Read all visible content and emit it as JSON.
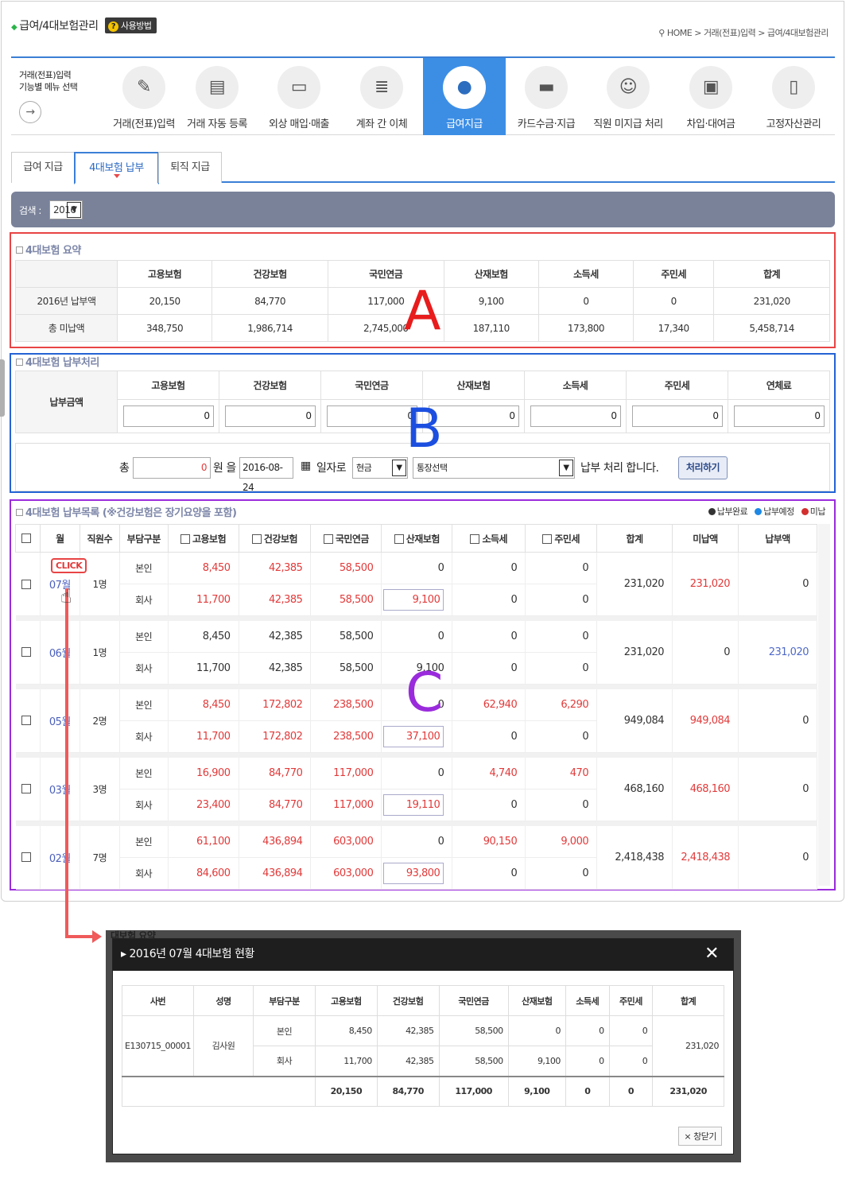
{
  "header": {
    "title": "급여/4대보험관리",
    "help_label": "사용방법",
    "breadcrumb": "HOME > 거래(전표)입력 > 급여/4대보험관리"
  },
  "menu": {
    "intro": "거래(전표)입력\n기능별 메뉴 선택",
    "items": [
      {
        "label": "거래(전표)입력",
        "icon": "document-edit-icon"
      },
      {
        "label": "거래 자동 등록",
        "icon": "server-icon"
      },
      {
        "label": "외상 매입·매출",
        "icon": "cash-icon"
      },
      {
        "label": "계좌 간 이체",
        "icon": "ledger-icon"
      },
      {
        "label": "급여지급",
        "icon": "person-icon"
      },
      {
        "label": "카드수금·지급",
        "icon": "card-icon"
      },
      {
        "label": "직원 미지급 처리",
        "icon": "staff-icon"
      },
      {
        "label": "차입·대여금",
        "icon": "briefcase-icon"
      },
      {
        "label": "고정자산관리",
        "icon": "asset-doc-icon"
      }
    ]
  },
  "tabs": [
    "급여 지급",
    "4대보험 납부",
    "퇴직 지급"
  ],
  "search": {
    "label": "검색 :",
    "year": "2016"
  },
  "summary": {
    "title": "4대보험 요약",
    "headers": [
      "고용보험",
      "건강보험",
      "국민연금",
      "산재보험",
      "소득세",
      "주민세",
      "합계"
    ],
    "rows": [
      {
        "label": "2016년 납부액",
        "values": [
          "20,150",
          "84,770",
          "117,000",
          "9,100",
          "0",
          "0",
          "231,020"
        ]
      },
      {
        "label": "총 미납액",
        "values": [
          "348,750",
          "1,986,714",
          "2,745,000",
          "187,110",
          "173,800",
          "17,340",
          "5,458,714"
        ]
      }
    ]
  },
  "payment": {
    "title": "4대보험 납부처리",
    "row_label": "납부금액",
    "headers": [
      "고용보험",
      "건강보험",
      "국민연금",
      "산재보험",
      "소득세",
      "주민세",
      "연체료"
    ],
    "values": [
      "0",
      "0",
      "0",
      "0",
      "0",
      "0",
      "0"
    ],
    "total_label": "총",
    "total_value": "0",
    "won_label": "원 을",
    "date": "2016-08-24",
    "date_suffix": "일자로",
    "method": "현금",
    "account": "통장선택",
    "suffix": "납부 처리 합니다.",
    "process_button": "처리하기"
  },
  "list": {
    "title": "4대보험 납부목록 (※건강보험은 장기요양을 포함)",
    "legend": [
      {
        "label": "납부완료",
        "color": "#333333"
      },
      {
        "label": "납부예정",
        "color": "#1e88e5"
      },
      {
        "label": "미납",
        "color": "#d32f2f"
      }
    ],
    "headers": [
      "월",
      "직원수",
      "부담구분",
      "고용보험",
      "건강보험",
      "국민연금",
      "산재보험",
      "소득세",
      "주민세",
      "합계",
      "미납액",
      "납부액"
    ],
    "rows": [
      {
        "month": "07월",
        "staff": "1명",
        "self": [
          "8,450",
          "42,385",
          "58,500",
          "0",
          "0",
          "0"
        ],
        "company": [
          "11,700",
          "42,385",
          "58,500",
          "9,100",
          "0",
          "0"
        ],
        "total": "231,020",
        "unpaid": "231,020",
        "paid": "0",
        "status": "unpaid"
      },
      {
        "month": "06월",
        "staff": "1명",
        "self": [
          "8,450",
          "42,385",
          "58,500",
          "0",
          "0",
          "0"
        ],
        "company": [
          "11,700",
          "42,385",
          "58,500",
          "9,100",
          "0",
          "0"
        ],
        "total": "231,020",
        "unpaid": "0",
        "paid": "231,020",
        "status": "paid"
      },
      {
        "month": "05월",
        "staff": "2명",
        "self": [
          "8,450",
          "172,802",
          "238,500",
          "0",
          "62,940",
          "6,290"
        ],
        "company": [
          "11,700",
          "172,802",
          "238,500",
          "37,100",
          "0",
          "0"
        ],
        "total": "949,084",
        "unpaid": "949,084",
        "paid": "0",
        "status": "unpaid"
      },
      {
        "month": "03월",
        "staff": "3명",
        "self": [
          "16,900",
          "84,770",
          "117,000",
          "0",
          "4,740",
          "470"
        ],
        "company": [
          "23,400",
          "84,770",
          "117,000",
          "19,110",
          "0",
          "0"
        ],
        "total": "468,160",
        "unpaid": "468,160",
        "paid": "0",
        "status": "unpaid"
      },
      {
        "month": "02월",
        "staff": "7명",
        "self": [
          "61,100",
          "436,894",
          "603,000",
          "0",
          "90,150",
          "9,000"
        ],
        "company": [
          "84,600",
          "436,894",
          "603,000",
          "93,800",
          "0",
          "0"
        ],
        "total": "2,418,438",
        "unpaid": "2,418,438",
        "paid": "0",
        "status": "unpaid"
      }
    ],
    "self_label": "본인",
    "company_label": "회사"
  },
  "annotations": {
    "a": "A",
    "b": "B",
    "c": "C",
    "click": "CLICK"
  },
  "modal": {
    "title": "2016년 07월 4대보험 현황",
    "headers": [
      "사번",
      "성명",
      "부담구분",
      "고용보험",
      "건강보험",
      "국민연금",
      "산재보험",
      "소득세",
      "주민세",
      "합계"
    ],
    "emp_no": "E130715_00001",
    "name": "김사원",
    "self": [
      "8,450",
      "42,385",
      "58,500",
      "0",
      "0",
      "0"
    ],
    "company": [
      "11,700",
      "42,385",
      "58,500",
      "9,100",
      "0",
      "0"
    ],
    "total": "231,020",
    "sums": [
      "20,150",
      "84,770",
      "117,000",
      "9,100",
      "0",
      "0",
      "231,020"
    ],
    "close_label": "창닫기",
    "behind_text": "대보험 요약"
  }
}
